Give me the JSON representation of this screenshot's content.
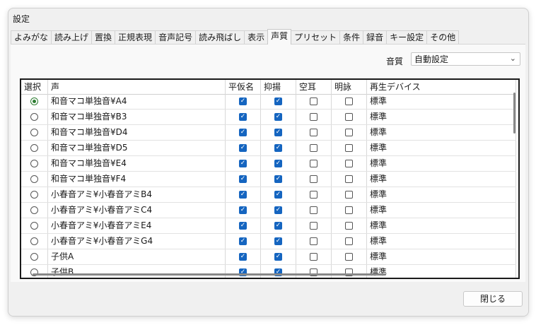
{
  "window": {
    "title": "設定"
  },
  "tabs": [
    {
      "label": "よみがな"
    },
    {
      "label": "読み上げ"
    },
    {
      "label": "置換"
    },
    {
      "label": "正規表現"
    },
    {
      "label": "音声記号"
    },
    {
      "label": "読み飛ばし"
    },
    {
      "label": "表示"
    },
    {
      "label": "声質",
      "active": true
    },
    {
      "label": "プリセット"
    },
    {
      "label": "条件"
    },
    {
      "label": "録音"
    },
    {
      "label": "キー設定"
    },
    {
      "label": "その他"
    }
  ],
  "quality": {
    "label": "音質",
    "value": "自動設定"
  },
  "table": {
    "columns": [
      "選択",
      "声",
      "平仮名",
      "抑揚",
      "空耳",
      "明詠",
      "再生デバイス"
    ],
    "rows": [
      {
        "selected": true,
        "voice": "和音マコ単独音¥A4",
        "hiragana": true,
        "intonation": true,
        "soramimi": false,
        "meiei": false,
        "device": "標準"
      },
      {
        "selected": false,
        "voice": "和音マコ単独音¥B3",
        "hiragana": true,
        "intonation": true,
        "soramimi": false,
        "meiei": false,
        "device": "標準"
      },
      {
        "selected": false,
        "voice": "和音マコ単独音¥D4",
        "hiragana": true,
        "intonation": true,
        "soramimi": false,
        "meiei": false,
        "device": "標準"
      },
      {
        "selected": false,
        "voice": "和音マコ単独音¥D5",
        "hiragana": true,
        "intonation": true,
        "soramimi": false,
        "meiei": false,
        "device": "標準"
      },
      {
        "selected": false,
        "voice": "和音マコ単独音¥E4",
        "hiragana": true,
        "intonation": true,
        "soramimi": false,
        "meiei": false,
        "device": "標準"
      },
      {
        "selected": false,
        "voice": "和音マコ単独音¥F4",
        "hiragana": true,
        "intonation": true,
        "soramimi": false,
        "meiei": false,
        "device": "標準"
      },
      {
        "selected": false,
        "voice": "小春音アミ¥小春音アミB4",
        "hiragana": true,
        "intonation": true,
        "soramimi": false,
        "meiei": false,
        "device": "標準"
      },
      {
        "selected": false,
        "voice": "小春音アミ¥小春音アミC4",
        "hiragana": true,
        "intonation": true,
        "soramimi": false,
        "meiei": false,
        "device": "標準"
      },
      {
        "selected": false,
        "voice": "小春音アミ¥小春音アミE4",
        "hiragana": true,
        "intonation": true,
        "soramimi": false,
        "meiei": false,
        "device": "標準"
      },
      {
        "selected": false,
        "voice": "小春音アミ¥小春音アミG4",
        "hiragana": true,
        "intonation": true,
        "soramimi": false,
        "meiei": false,
        "device": "標準"
      },
      {
        "selected": false,
        "voice": "子供A",
        "hiragana": true,
        "intonation": true,
        "soramimi": false,
        "meiei": false,
        "device": "標準"
      },
      {
        "selected": false,
        "voice": "子供B",
        "hiragana": true,
        "intonation": true,
        "soramimi": false,
        "meiei": false,
        "device": "標準"
      }
    ]
  },
  "footer": {
    "close_label": "閉じる"
  },
  "colors": {
    "checkbox": "#1565c0",
    "radio": "#2e7d32"
  }
}
